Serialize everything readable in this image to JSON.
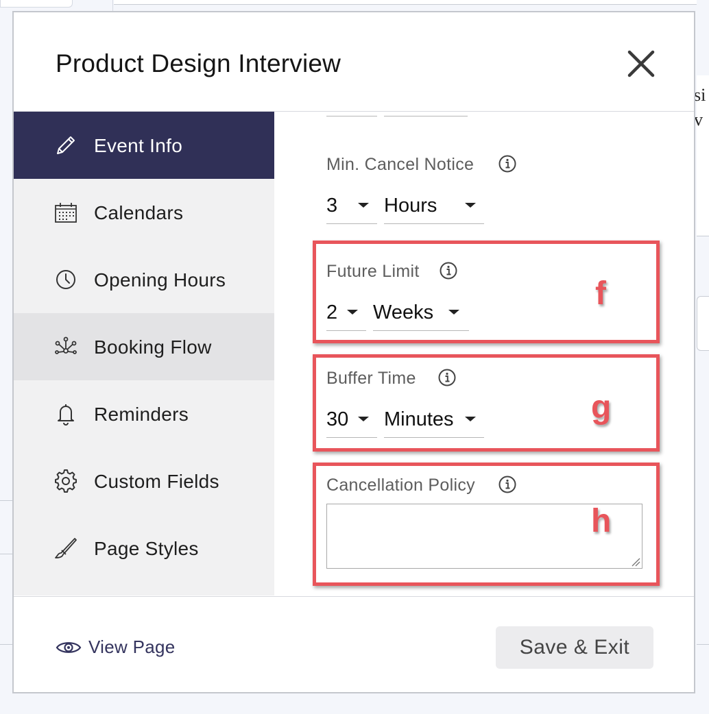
{
  "modal": {
    "title": "Product Design Interview"
  },
  "background": {
    "right_text_1": "si",
    "right_text_2": "v"
  },
  "sidebar": {
    "items": [
      {
        "label": "Event Info",
        "icon": "pencil-icon",
        "state": "active"
      },
      {
        "label": "Calendars",
        "icon": "calendar-icon"
      },
      {
        "label": "Opening Hours",
        "icon": "clock-icon"
      },
      {
        "label": "Booking Flow",
        "icon": "flow-icon",
        "state": "hover"
      },
      {
        "label": "Reminders",
        "icon": "bell-icon"
      },
      {
        "label": "Custom Fields",
        "icon": "gear-icon"
      },
      {
        "label": "Page Styles",
        "icon": "brush-icon"
      }
    ]
  },
  "fields": {
    "min_cancel": {
      "label": "Min. Cancel Notice",
      "value": "3",
      "unit": "Hours"
    },
    "future_limit": {
      "label": "Future Limit",
      "value": "2",
      "unit": "Weeks",
      "annotation": "f"
    },
    "buffer_time": {
      "label": "Buffer Time",
      "value": "30",
      "unit": "Minutes",
      "annotation": "g"
    },
    "cancellation_policy": {
      "label": "Cancellation Policy",
      "value": "",
      "annotation": "h"
    }
  },
  "footer": {
    "view_page": "View Page",
    "save_exit": "Save & Exit"
  },
  "colors": {
    "sidebar_active": "#303057",
    "sidebar_hover": "#e3e3e5",
    "annotation": "#e8555b",
    "link": "#34345e"
  }
}
